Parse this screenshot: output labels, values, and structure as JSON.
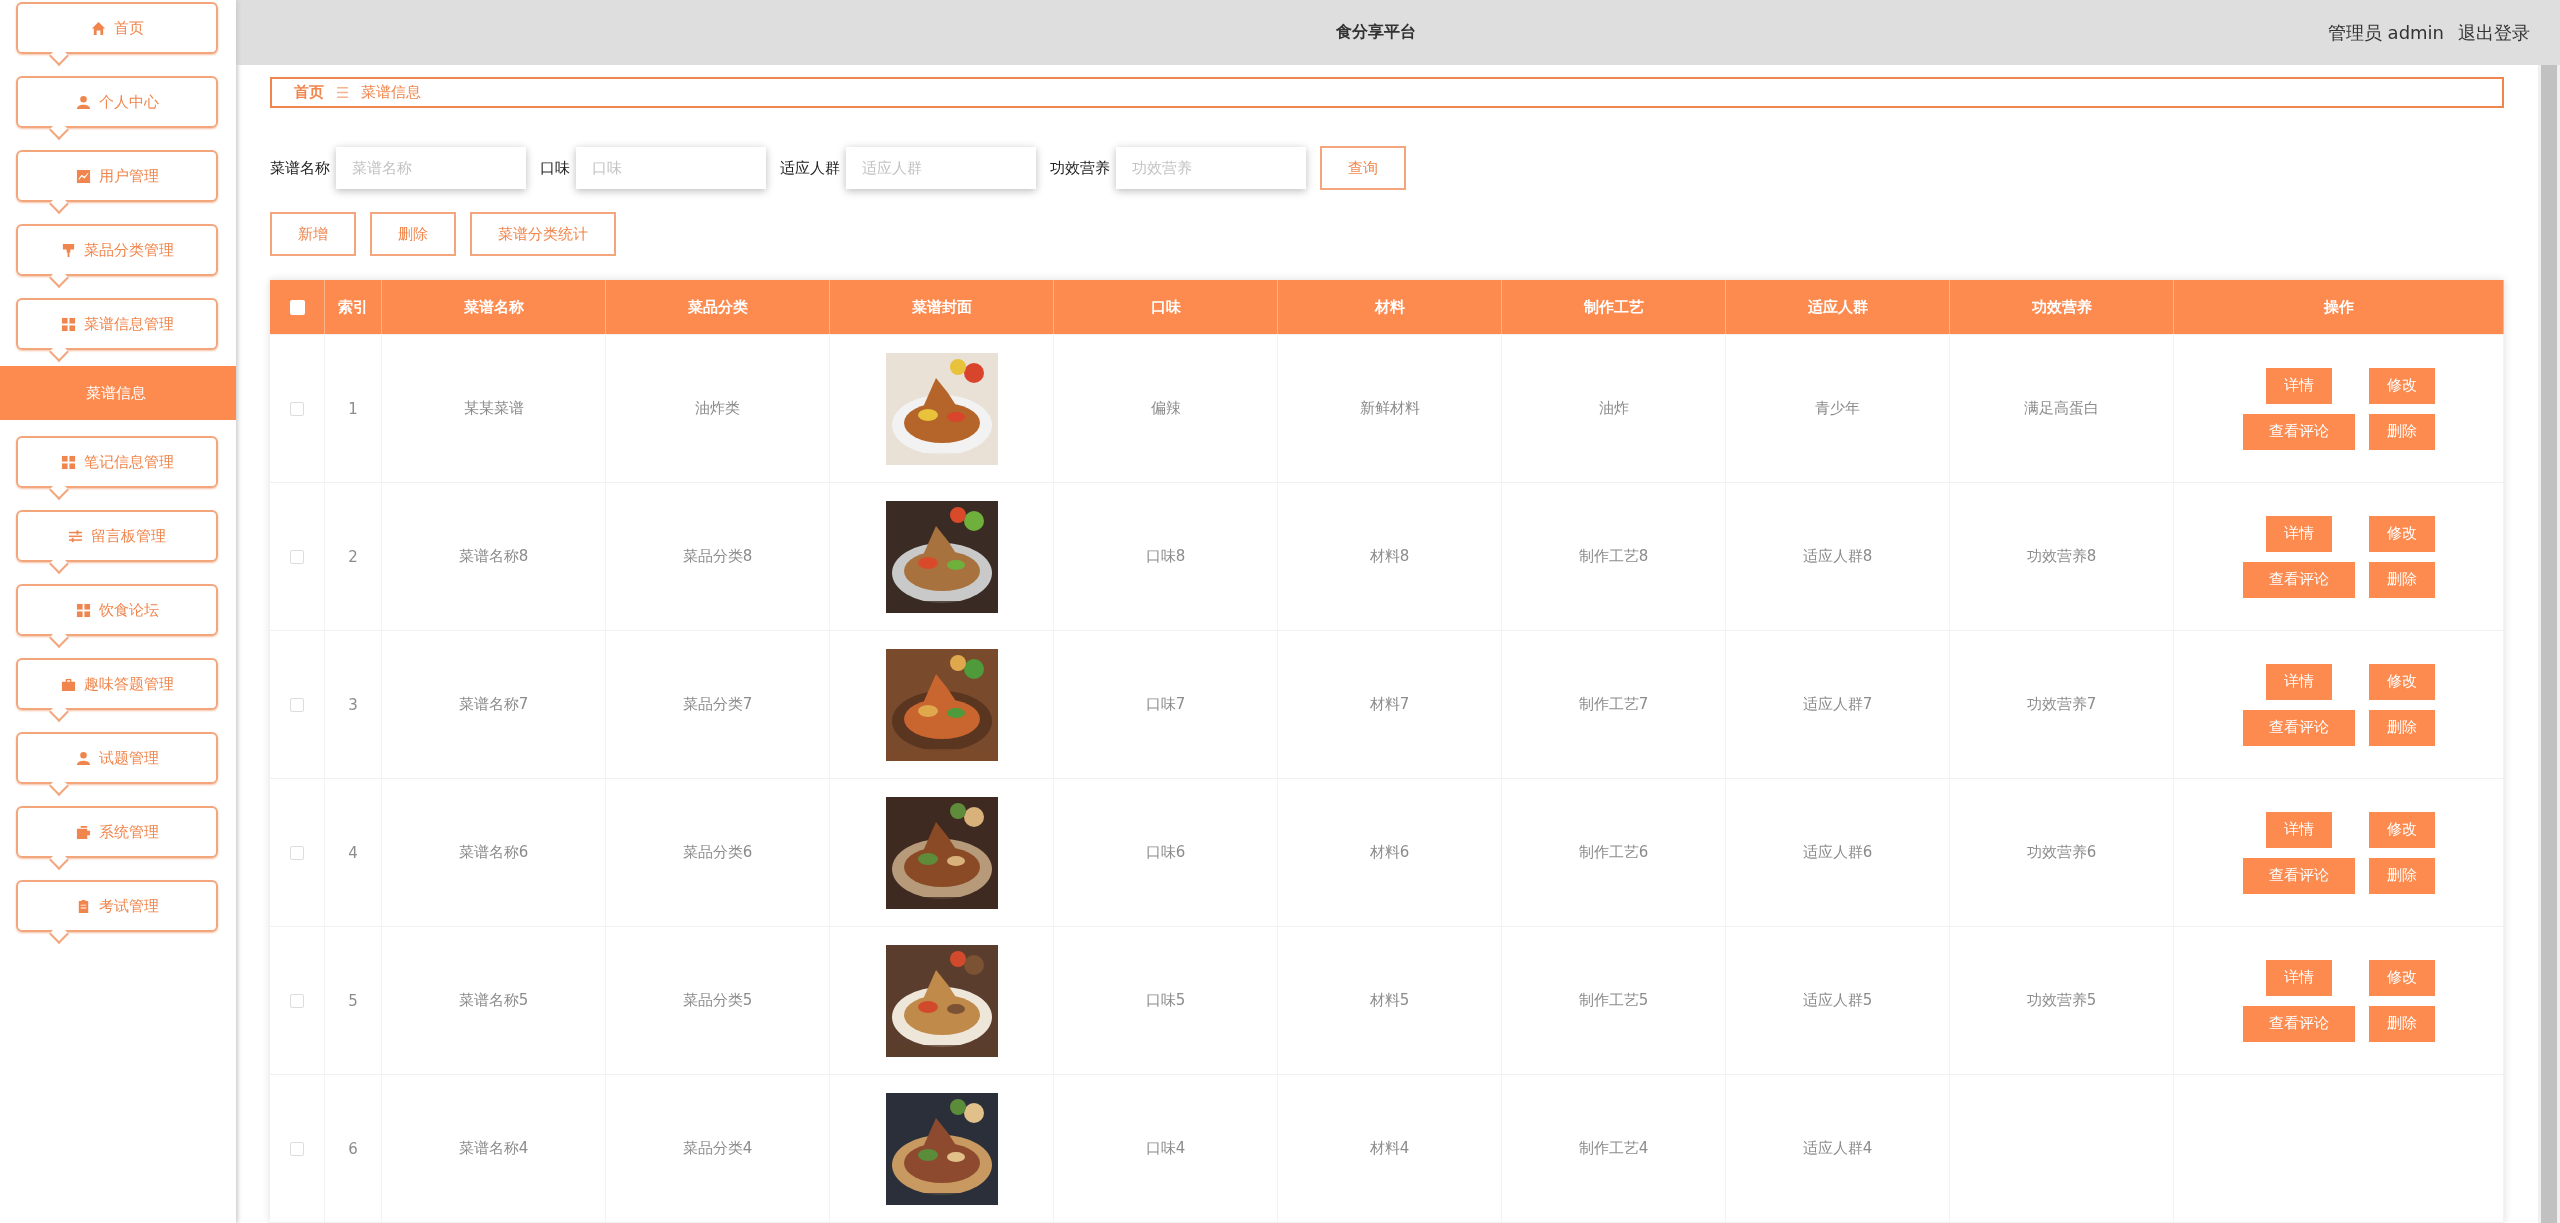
{
  "header": {
    "title": "食分享平台",
    "user_label": "管理员 admin",
    "logout": "退出登录"
  },
  "sidebar": {
    "items": [
      {
        "label": "首页",
        "selected": false
      },
      {
        "label": "个人中心",
        "selected": false
      },
      {
        "label": "用户管理",
        "selected": false
      },
      {
        "label": "菜品分类管理",
        "selected": false
      },
      {
        "label": "菜谱信息管理",
        "selected": false,
        "children": [
          {
            "label": "菜谱信息",
            "selected": true
          }
        ]
      },
      {
        "label": "笔记信息管理",
        "selected": false
      },
      {
        "label": "留言板管理",
        "selected": false
      },
      {
        "label": "饮食论坛",
        "selected": false
      },
      {
        "label": "趣味答题管理",
        "selected": false
      },
      {
        "label": "试题管理",
        "selected": false
      },
      {
        "label": "系统管理",
        "selected": false
      },
      {
        "label": "考试管理",
        "selected": false
      }
    ]
  },
  "breadcrumb": {
    "home": "首页",
    "separator": "☰",
    "current": "菜谱信息"
  },
  "search": {
    "fields": [
      {
        "label": "菜谱名称",
        "placeholder": "菜谱名称"
      },
      {
        "label": "口味",
        "placeholder": "口味"
      },
      {
        "label": "适应人群",
        "placeholder": "适应人群"
      },
      {
        "label": "功效营养",
        "placeholder": "功效营养"
      }
    ],
    "button": "查询"
  },
  "actions": [
    "新增",
    "删除",
    "菜谱分类统计"
  ],
  "table": {
    "select_all": {
      "checked": false
    },
    "columns": [
      "索引",
      "菜谱名称",
      "菜品分类",
      "菜谱封面",
      "口味",
      "材料",
      "制作工艺",
      "适应人群",
      "功效营养",
      "操作"
    ],
    "rows": [
      {
        "checked": false,
        "index": "1",
        "name": "某某菜谱",
        "category": "油炸类",
        "taste": "偏辣",
        "material": "新鲜材料",
        "craft": "油炸",
        "crowd": "青少年",
        "effect": "满足高蛋白",
        "actions": [
          "详情",
          "修改",
          "查看评论",
          "删除"
        ]
      },
      {
        "checked": false,
        "index": "2",
        "name": "菜谱名称8",
        "category": "菜品分类8",
        "taste": "口味8",
        "material": "材料8",
        "craft": "制作工艺8",
        "crowd": "适应人群8",
        "effect": "功效营养8",
        "actions": [
          "详情",
          "修改",
          "查看评论",
          "删除"
        ]
      },
      {
        "checked": false,
        "index": "3",
        "name": "菜谱名称7",
        "category": "菜品分类7",
        "taste": "口味7",
        "material": "材料7",
        "craft": "制作工艺7",
        "crowd": "适应人群7",
        "effect": "功效营养7",
        "actions": [
          "详情",
          "修改",
          "查看评论",
          "删除"
        ]
      },
      {
        "checked": false,
        "index": "4",
        "name": "菜谱名称6",
        "category": "菜品分类6",
        "taste": "口味6",
        "material": "材料6",
        "craft": "制作工艺6",
        "crowd": "适应人群6",
        "effect": "功效营养6",
        "actions": [
          "详情",
          "修改",
          "查看评论",
          "删除"
        ]
      },
      {
        "checked": false,
        "index": "5",
        "name": "菜谱名称5",
        "category": "菜品分类5",
        "taste": "口味5",
        "material": "材料5",
        "craft": "制作工艺5",
        "crowd": "适应人群5",
        "effect": "功效营养5",
        "actions": [
          "详情",
          "修改",
          "查看评论",
          "删除"
        ]
      },
      {
        "checked": false,
        "index": "6",
        "name": "菜谱名称4",
        "category": "菜品分类4",
        "taste": "口味4",
        "material": "材料4",
        "craft": "制作工艺4",
        "crowd": "适应人群4"
      }
    ]
  }
}
